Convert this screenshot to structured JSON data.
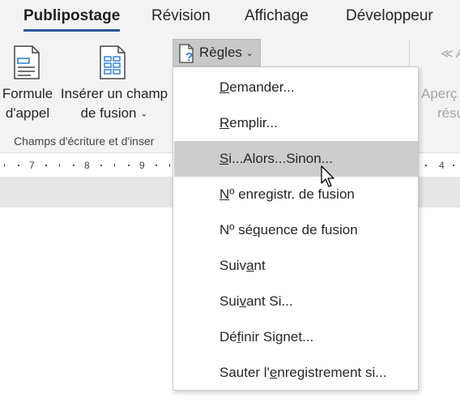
{
  "ribbon": {
    "tabs": [
      {
        "label": "Publipostage",
        "active": true
      },
      {
        "label": "Révision"
      },
      {
        "label": "Affichage"
      },
      {
        "label": "Développeur"
      }
    ],
    "formule_line1": "Formule",
    "formule_line2": "d'appel",
    "inserer_line1": "Insérer un champ",
    "inserer_line2": "de fusion",
    "inserer_chevron": "⌄",
    "group_label": "Champs d'écriture et d'inser",
    "regles_label": "Règles",
    "regles_chevron": "⌄",
    "apercu_line1": "Aperç",
    "apercu_line2": "résul",
    "apercu_icon_text": "≪ AB",
    "accent_color": "#2b579a"
  },
  "ruler": {
    "marks": "·ı·7·ı·8·ı·9·ı"
  },
  "menu": {
    "items": [
      {
        "pre": "",
        "u": "D",
        "post": "emander..."
      },
      {
        "pre": "",
        "u": "R",
        "post": "emplir..."
      },
      {
        "pre": "",
        "u": "S",
        "post": "i...Alors...Sinon..."
      },
      {
        "pre": "",
        "u": "N",
        "post": "º enregistr. de fusion"
      },
      {
        "pre": "Nº sé",
        "u": "q",
        "post": "uence de fusion"
      },
      {
        "pre": "Suiv",
        "u": "a",
        "post": "nt"
      },
      {
        "pre": "Sui",
        "u": "v",
        "post": "ant Si..."
      },
      {
        "pre": "Dé",
        "u": "f",
        "post": "inir Signet..."
      },
      {
        "pre": "Sauter l'",
        "u": "e",
        "post": "nregistrement si..."
      }
    ],
    "hover_index": 2
  }
}
